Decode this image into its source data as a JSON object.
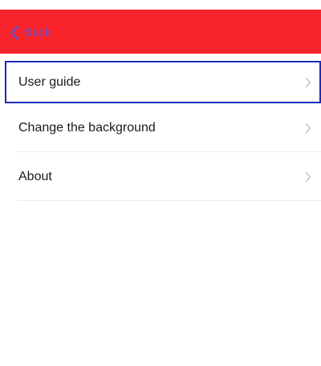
{
  "header": {
    "back_label": "Back",
    "back_icon": "chevron-left-icon",
    "background_color": "#f8232b",
    "back_color": "#6b4fc8"
  },
  "menu": {
    "items": [
      {
        "label": "User guide",
        "selected": true,
        "icon": "chevron-right-icon"
      },
      {
        "label": "Change the background",
        "selected": false,
        "icon": "chevron-right-icon"
      },
      {
        "label": "About",
        "selected": false,
        "icon": "chevron-right-icon"
      }
    ],
    "selection_color": "#1c2bb8"
  }
}
